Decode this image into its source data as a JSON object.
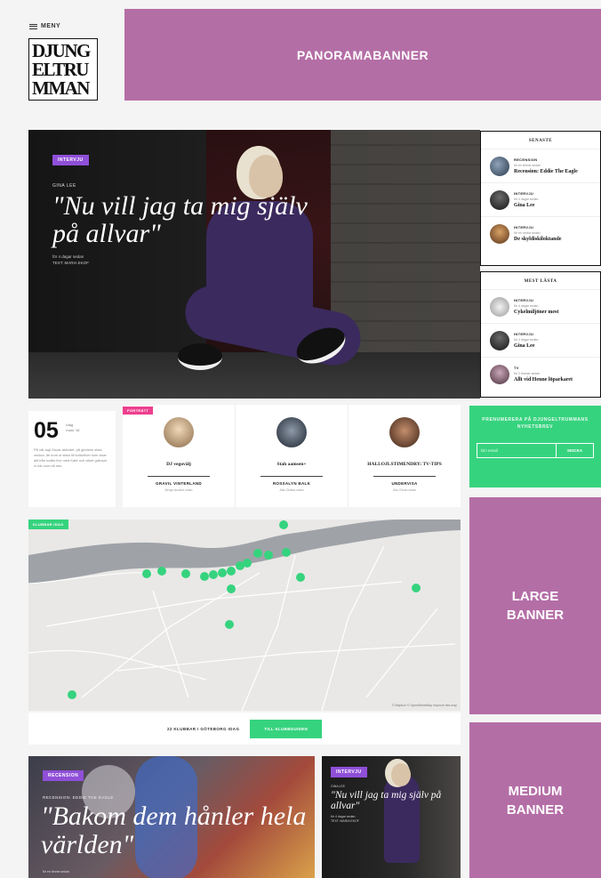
{
  "header": {
    "menu_label": "MENY",
    "logo_lines": [
      "DJUNG",
      "ELTRU",
      "MMAN"
    ]
  },
  "banners": {
    "panorama": "PANORAMABANNER",
    "large_1": "LARGE",
    "large_2": "BANNER",
    "medium_1": "MEDIUM",
    "medium_2": "BANNER"
  },
  "hero": {
    "tag": "INTERVJU",
    "kicker": "GINA LEE",
    "headline": "\"Nu vill jag ta mig själv på allvar\"",
    "byline_1": "för 4 dagar sedan",
    "byline_2": "TEXT: MARIA EKOF"
  },
  "senaste": {
    "title": "SENASTE",
    "items": [
      {
        "category": "RECENSION",
        "sub": "för en timme sedan",
        "headline": "Recension: Eddie The Eagle"
      },
      {
        "category": "INTERVJU",
        "sub": "för 4 dagar sedan",
        "headline": "Gina Lee"
      },
      {
        "category": "INTERVJU",
        "sub": "för en vecka sedan",
        "headline": "De skyldiskiloktande"
      }
    ]
  },
  "mest_lasta": {
    "title": "MEST LÄSTA",
    "items": [
      {
        "category": "INTERVJU",
        "sub": "för 4 dagar sedan",
        "headline": "Cykelmiljöner mest"
      },
      {
        "category": "INTERVJU",
        "sub": "för 4 dagar sedan",
        "headline": "Gina Lee"
      },
      {
        "category": "TV",
        "sub": "för 2 timmar sedan",
        "headline": "Allt vid Henne löparkaret"
      }
    ]
  },
  "datebox": {
    "day": "05",
    "side_1": "Idag",
    "side_2": "mars '16",
    "body": "På vår sajt Oscar aktivitet, på glödens sista veckor, de kom ut sista till kulturlivet som visar allt från kvälls live med Kafé och vilket gränsar vi när som så ses."
  },
  "cards": {
    "tag": "PORTRÄTT",
    "items": [
      {
        "name": "DJ vegovälj",
        "role": "GRAVIL VINTERLAND",
        "sub": "Bergs student sidan"
      },
      {
        "name": "Stah aamsen+",
        "role": "ROSSALYN BALK",
        "sub": "Alla Ghiska sidan"
      },
      {
        "name": "HALLOJLSTIMENDRY: TV-TIPS",
        "role": "UNDERVISA",
        "sub": "Alla Göran sidan"
      }
    ]
  },
  "newsletter": {
    "title": "PRENUMERERA PÅ DJUNGELTRUMMANS NYHETSBREV",
    "placeholder": "Din email",
    "button": "SKICKA"
  },
  "map": {
    "tag": "KLUBBAR IDAG",
    "credit": "© Mapbox © OpenStreetMap Improve this map"
  },
  "clubs": {
    "text": "22 KLUBBAR I GÖTEBORG IDAG",
    "button": "TILL KLUBBGUIDEN"
  },
  "article_large": {
    "tag": "RECENSION",
    "kicker": "RECENSION: EDDIE THE EAGLE",
    "headline": "\"Bakom dem hånler hela världen\"",
    "byline": "för en timme sedan"
  },
  "article_small": {
    "tag": "INTERVJU",
    "kicker": "GINA LEE",
    "headline": "\"Nu vill jag ta mig själv på allvar\"",
    "byline_1": "för 4 dagar sedan",
    "byline_2": "TEXT: MARIA EKOF"
  },
  "colors": {
    "banner": "#b46ea6",
    "green": "#36d37e",
    "purple_tag": "#8f4fd8",
    "pink_tag": "#ee3f8f"
  }
}
